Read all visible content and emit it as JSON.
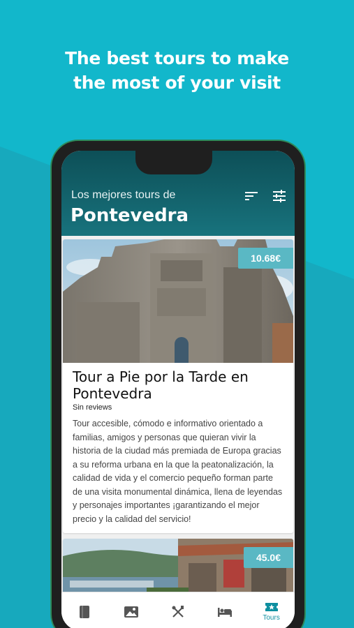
{
  "headline": {
    "line1": "The best tours to make",
    "line2": "the most of your visit"
  },
  "header": {
    "subtitle": "Los mejores tours de",
    "city": "Pontevedra",
    "icons": [
      "sort-icon",
      "filter-icon"
    ]
  },
  "tours": [
    {
      "price": "10.68€",
      "title": "Tour a Pie por la Tarde en Pontevedra",
      "reviews": "Sin reviews",
      "description": "Tour accesible, cómodo e informativo orientado a familias, amigos y personas que quieran vivir la historia de la ciudad más premiada de Europa gracias a su reforma urbana en la que la peatonalización, la calidad de vida y el comercio pequeño forman parte de una visita monumental dinámica, llena de leyendas y personajes importantes ¡garantizando el mejor precio y la calidad del servicio!"
    },
    {
      "price": "45.0€"
    }
  ],
  "bottom_nav": [
    {
      "icon": "book-icon",
      "label": ""
    },
    {
      "icon": "image-icon",
      "label": ""
    },
    {
      "icon": "restaurant-icon",
      "label": ""
    },
    {
      "icon": "bed-icon",
      "label": ""
    },
    {
      "icon": "ticket-icon",
      "label": "Tours"
    }
  ],
  "colors": {
    "background": "#12b7cb",
    "header_dark": "#0d4f57",
    "accent": "#0e8fa0",
    "price_badge": "#5ab8c4"
  }
}
